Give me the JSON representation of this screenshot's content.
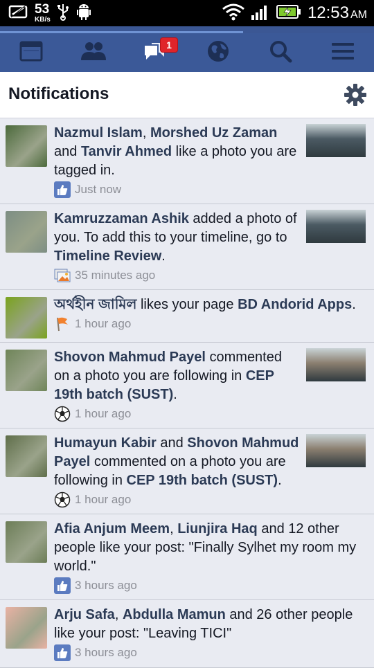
{
  "status_bar": {
    "speed_value": "53",
    "speed_unit": "KB/s",
    "time": "12:53",
    "ampm": "AM"
  },
  "loading_progress": 0.65,
  "nav": {
    "items": [
      {
        "icon": "news-feed-icon"
      },
      {
        "icon": "friends-icon"
      },
      {
        "icon": "messages-icon",
        "badge": "1"
      },
      {
        "icon": "globe-icon"
      },
      {
        "icon": "search-icon"
      },
      {
        "icon": "menu-icon"
      }
    ]
  },
  "header": {
    "title": "Notifications"
  },
  "notifications": [
    {
      "segments": [
        {
          "t": "Nazmul Islam",
          "b": true
        },
        {
          "t": ", ",
          "b": false
        },
        {
          "t": "Morshed Uz Zaman",
          "b": true
        },
        {
          "t": " and ",
          "b": false
        },
        {
          "t": "Tanvir Ahmed",
          "b": true
        },
        {
          "t": " like a photo you are tagged in.",
          "b": false
        }
      ],
      "meta_icon": "like-icon",
      "time": "Just now",
      "has_thumb": true,
      "avatar_color": "#4c6a3c",
      "thumb_color": "#4b5a63"
    },
    {
      "segments": [
        {
          "t": "Kamruzzaman Ashik",
          "b": true
        },
        {
          "t": " added a photo of you. To add this to your timeline, go to ",
          "b": false
        },
        {
          "t": "Timeline Review",
          "b": true
        },
        {
          "t": ".",
          "b": false
        }
      ],
      "meta_icon": "photo-icon",
      "time": "35 minutes ago",
      "has_thumb": true,
      "avatar_color": "#7d8e84",
      "thumb_color": "#4b5a63"
    },
    {
      "segments": [
        {
          "t": "অর্থহীন জামিল",
          "b": true
        },
        {
          "t": " likes your page ",
          "b": false
        },
        {
          "t": "BD Andorid Apps",
          "b": true
        },
        {
          "t": ".",
          "b": false
        }
      ],
      "meta_icon": "flag-icon",
      "time": "1 hour ago",
      "has_thumb": false,
      "avatar_color": "#7aa31e",
      "thumb_color": ""
    },
    {
      "segments": [
        {
          "t": "Shovon Mahmud Payel",
          "b": true
        },
        {
          "t": " commented on a photo you are following in ",
          "b": false
        },
        {
          "t": "CEP 19th batch (SUST)",
          "b": true
        },
        {
          "t": ".",
          "b": false
        }
      ],
      "meta_icon": "soccer-ball-icon",
      "time": "1 hour ago",
      "has_thumb": true,
      "avatar_color": "#6f8559",
      "thumb_color": "#8b7f70"
    },
    {
      "segments": [
        {
          "t": "Humayun Kabir",
          "b": true
        },
        {
          "t": " and ",
          "b": false
        },
        {
          "t": "Shovon Mahmud Payel",
          "b": true
        },
        {
          "t": " commented on a photo you are following in ",
          "b": false
        },
        {
          "t": "CEP 19th batch (SUST)",
          "b": true
        },
        {
          "t": ".",
          "b": false
        }
      ],
      "meta_icon": "soccer-ball-icon",
      "time": "1 hour ago",
      "has_thumb": true,
      "avatar_color": "#5f6e4a",
      "thumb_color": "#8b7f70"
    },
    {
      "segments": [
        {
          "t": "Afia Anjum Meem",
          "b": true
        },
        {
          "t": ", ",
          "b": false
        },
        {
          "t": "Liunjira Haq",
          "b": true
        },
        {
          "t": " and 12 other people like your post: \"Finally Sylhet my room my world.\"",
          "b": false
        }
      ],
      "meta_icon": "like-icon",
      "time": "3 hours ago",
      "has_thumb": false,
      "avatar_color": "#6c7d57",
      "thumb_color": ""
    },
    {
      "segments": [
        {
          "t": "Arju Safa",
          "b": true
        },
        {
          "t": ", ",
          "b": false
        },
        {
          "t": "Abdulla Mamun",
          "b": true
        },
        {
          "t": " and 26 other people like your post: \"Leaving TICI\"",
          "b": false
        }
      ],
      "meta_icon": "like-icon",
      "time": "3 hours ago",
      "has_thumb": false,
      "avatar_color": "#e9b2a4",
      "thumb_color": ""
    }
  ]
}
